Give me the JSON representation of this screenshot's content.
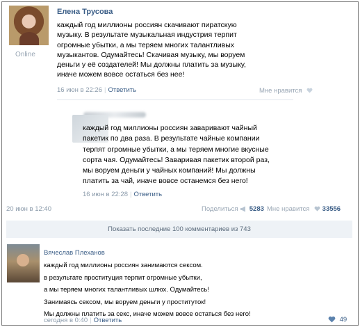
{
  "comment1": {
    "author": "Елена Трусова",
    "status": "Online",
    "lines": [
      "каждый год миллионы россиян скачивают пиратскую",
      "музыку. В результате музыкальная индустрия терпит",
      "огромные убытки, а мы теряем многих талантливых",
      "музыкантов. Одумайтесь! Скачивая музыку, мы воруем",
      "деньги у её создателей! Мы должны платить за музыку,",
      "иначе можем вовсе остаться без нее!"
    ],
    "date": "16 июн в 22:26",
    "reply": "Ответить",
    "like_label": "Мне нравится"
  },
  "comment2": {
    "lines": [
      "каждый год миллионы россиян заваривают чайный",
      "пакетик по два раза. В результате чайные компании",
      "терпят огромные убытки, а мы теряем многие вкусные",
      "сорта чая. Одумайтесь! Заваривая пакетик второй раз,",
      "мы воруем деньги у чайных компаний! Мы должны",
      "платить за чай, иначе вовсе останемся без него!"
    ],
    "date": "16 июн в 22:28",
    "reply": "Ответить"
  },
  "post_footer": {
    "date": "20 июн в 12:40",
    "share_label": "Поделиться",
    "share_count": "5283",
    "like_label": "Мне нравится",
    "like_count": "33556"
  },
  "show_more": "Показать последние 100 комментариев из 743",
  "comment3": {
    "author": "Вячеслав Плеханов",
    "lines": [
      "каждый год миллионы россиян занимаются сексом.",
      "в результате проституция терпит огромные убытки,",
      "а мы теряем многих талантливых шлюх. Одумайтесь!",
      "Занимаясь сексом, мы воруем деньги у проституток!",
      "Мы должны платить за секс, иначе можем вовсе остаться без него!"
    ],
    "date": "сегодня в 0:40",
    "reply": "Ответить",
    "like_count": "49"
  },
  "colors": {
    "link": "#3b5e87",
    "meta": "#8a9aaa",
    "bar": "#eef2f6"
  }
}
